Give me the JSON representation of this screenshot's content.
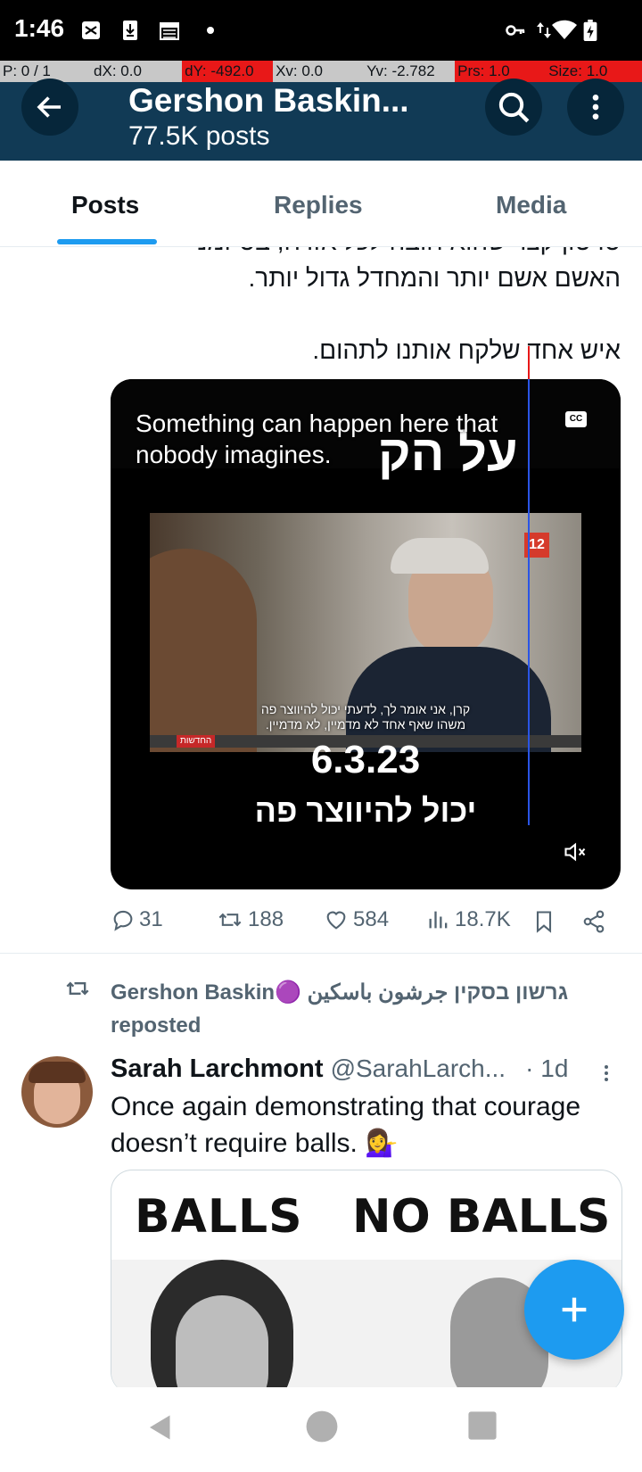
{
  "status_bar": {
    "time": "1:46",
    "icons": [
      "shuffle-icon",
      "download-icon",
      "calendar-icon",
      "dot-icon",
      "vpn-key-icon",
      "data-arrows-icon",
      "wifi-icon",
      "battery-charging-icon"
    ]
  },
  "pointer_bar": {
    "items": [
      {
        "text": "P: 0 / 1",
        "color": "#c8c8c8"
      },
      {
        "text": "dX: 0.0",
        "color": "#c8c8c8"
      },
      {
        "text": "dY: -492.0",
        "color": "#e81818"
      },
      {
        "text": "Xv: 0.0",
        "color": "#c8c8c8"
      },
      {
        "text": "Yv: -2.782",
        "color": "#c8c8c8"
      },
      {
        "text": "Prs: 1.0",
        "color": "#e81818"
      },
      {
        "text": "Size: 1.0",
        "color": "#e81818"
      }
    ]
  },
  "header": {
    "title": "Gershon Baskin...",
    "subtitle": "77.5K posts",
    "back_icon": "arrow-left-icon",
    "search_icon": "search-icon",
    "more_icon": "more-vertical-icon",
    "color": "#113a55"
  },
  "tabs": [
    {
      "label": "Posts",
      "active": true
    },
    {
      "label": "Replies",
      "active": false
    },
    {
      "label": "Media",
      "active": false
    }
  ],
  "post": {
    "text_line_cut": "סרטון קצר שהוא חובה לכל אזרח, בס זמנ",
    "text_line2": "האשם אשם יותר והמחדל גדול יותר.",
    "text_line3": "איש אחד שלקח אותנו לתהום.",
    "video": {
      "caption": "Something can happen here that nobody imagines.",
      "cc_label": "CC",
      "top_hebrew": "על הק",
      "channel_logo": "12",
      "subtitle_line1": "קרן, אני אומר לך, לדעתי יכול להיווצר פה",
      "subtitle_line2": "משהו שאף אחד לא מדמיין, לא מדמיין.",
      "news_label": "החדשות",
      "date": "6.3.23",
      "bottom_hebrew": "יכול להיווצר פה",
      "mute_icon": "volume-mute-icon"
    },
    "actions": {
      "replies": "31",
      "reposts": "188",
      "likes": "584",
      "views": "18.7K"
    }
  },
  "repost": {
    "reposter": "Gershon Baskin🟣 גרשון בסקין جرشون باسكين",
    "label": "reposted",
    "author_name": "Sarah Larchmont",
    "author_handle": "@SarahLarch...",
    "time": "· 1d",
    "text": "Once again demonstrating that courage doesn’t require balls. 💁‍♀️",
    "card_left": "BALLS",
    "card_right": "NO BALLS"
  },
  "fab_icon": "plus-icon",
  "nav": [
    "back-triangle-icon",
    "home-circle-icon",
    "recents-square-icon"
  ],
  "accent": "#1d9bf0"
}
